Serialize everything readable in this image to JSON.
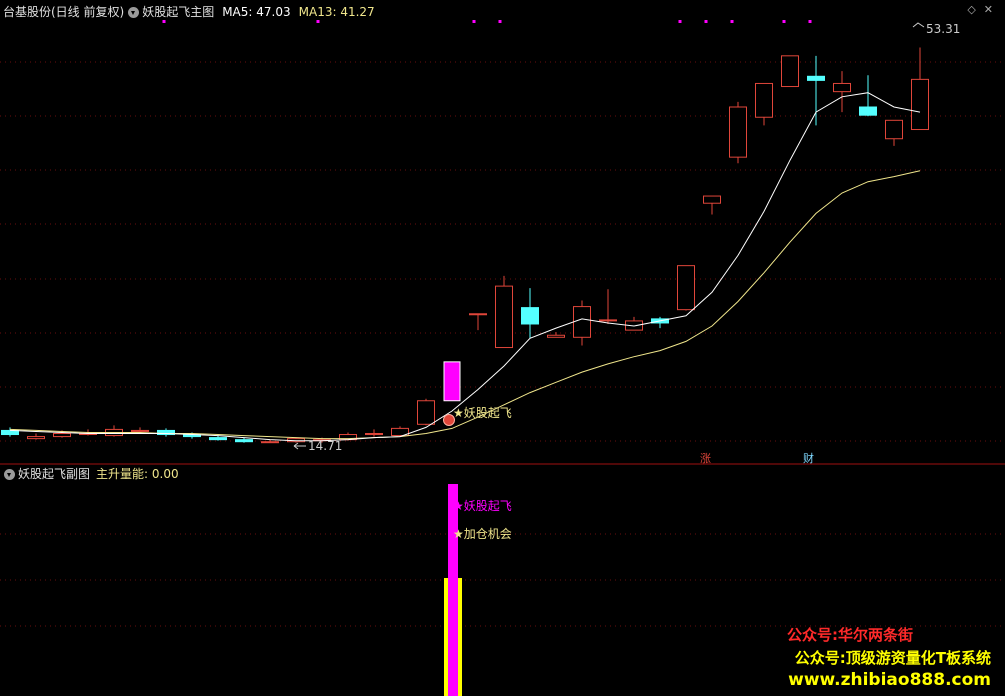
{
  "header": {
    "stock_name": "台基股份(日线 前复权)",
    "indicator_main": "妖股起飞主图",
    "ma5_label": "MA5: 47.03",
    "ma13_label": "MA13: 41.27"
  },
  "sub_header": {
    "indicator_sub": "妖股起飞副图",
    "value_label": "主升量能: 0.00"
  },
  "annotations": {
    "high_price": "53.31",
    "low_price": "14.71",
    "signal_main": "★妖股起飞",
    "signal_sub_1": "★妖股起飞",
    "signal_sub_2": "★加仓机会",
    "marker_zhang": "涨",
    "marker_cai": "财"
  },
  "watermark": {
    "line1": "公众号:华尔两条街",
    "line2": "公众号:顶级游资量化T板系统",
    "line3": "www.zhibiao888.com"
  },
  "colors": {
    "up": "#e0463a",
    "down": "#54ffff",
    "ma5": "#ffffff",
    "ma13": "#f0e68c",
    "signal": "#ff00ff",
    "volume_yellow": "#ffff00",
    "watermark_red": "#ff2a2a",
    "watermark_yellow": "#ffff00"
  },
  "chart_data": {
    "type": "candlestick",
    "price_range": [
      13.5,
      56
    ],
    "candles": [
      {
        "o": 15.9,
        "c": 15.5,
        "h": 16.2,
        "l": 15.3
      },
      {
        "o": 15.1,
        "c": 15.3,
        "h": 15.6,
        "l": 15.0
      },
      {
        "o": 15.3,
        "c": 15.6,
        "h": 15.9,
        "l": 15.2
      },
      {
        "o": 15.6,
        "c": 15.6,
        "h": 16.0,
        "l": 15.4
      },
      {
        "o": 15.4,
        "c": 16.0,
        "h": 16.4,
        "l": 15.3
      },
      {
        "o": 15.8,
        "c": 15.9,
        "h": 16.2,
        "l": 15.6
      },
      {
        "o": 15.9,
        "c": 15.5,
        "h": 16.1,
        "l": 15.3
      },
      {
        "o": 15.5,
        "c": 15.3,
        "h": 15.7,
        "l": 15.1
      },
      {
        "o": 15.2,
        "c": 15.0,
        "h": 15.4,
        "l": 14.9
      },
      {
        "o": 15.0,
        "c": 14.8,
        "h": 15.2,
        "l": 14.7
      },
      {
        "o": 14.8,
        "c": 14.8,
        "h": 15.0,
        "l": 14.7
      },
      {
        "o": 14.8,
        "c": 15.1,
        "h": 15.2,
        "l": 14.7
      },
      {
        "o": 14.9,
        "c": 15.0,
        "h": 15.2,
        "l": 14.71
      },
      {
        "o": 15.0,
        "c": 15.5,
        "h": 15.7,
        "l": 14.9
      },
      {
        "o": 15.5,
        "c": 15.6,
        "h": 16.0,
        "l": 15.3
      },
      {
        "o": 15.4,
        "c": 16.1,
        "h": 16.3,
        "l": 15.3
      },
      {
        "o": 16.5,
        "c": 18.8,
        "h": 19.0,
        "l": 16.4
      },
      {
        "o": 18.8,
        "c": 22.6,
        "h": 22.6,
        "l": 18.8
      },
      {
        "o": 27.3,
        "c": 27.3,
        "h": 27.3,
        "l": 25.7
      },
      {
        "o": 24.0,
        "c": 30.0,
        "h": 31.0,
        "l": 24.0
      },
      {
        "o": 27.9,
        "c": 26.3,
        "h": 29.8,
        "l": 24.9
      },
      {
        "o": 25.0,
        "c": 25.2,
        "h": 25.5,
        "l": 25.0
      },
      {
        "o": 25.0,
        "c": 28.0,
        "h": 28.6,
        "l": 24.2
      },
      {
        "o": 26.7,
        "c": 26.7,
        "h": 29.7,
        "l": 26.3
      },
      {
        "o": 25.7,
        "c": 26.6,
        "h": 27.0,
        "l": 25.7
      },
      {
        "o": 26.8,
        "c": 26.4,
        "h": 27.0,
        "l": 25.9
      },
      {
        "o": 27.7,
        "c": 32.0,
        "h": 32.0,
        "l": 27.6
      },
      {
        "o": 38.1,
        "c": 38.8,
        "h": 38.8,
        "l": 37.0
      },
      {
        "o": 42.6,
        "c": 47.5,
        "h": 48.0,
        "l": 42.0
      },
      {
        "o": 46.5,
        "c": 49.8,
        "h": 49.8,
        "l": 45.7
      },
      {
        "o": 49.5,
        "c": 52.5,
        "h": 52.5,
        "l": 49.5
      },
      {
        "o": 50.5,
        "c": 50.1,
        "h": 52.5,
        "l": 45.7
      },
      {
        "o": 49.0,
        "c": 49.8,
        "h": 51.0,
        "l": 47.0
      },
      {
        "o": 47.5,
        "c": 46.7,
        "h": 50.6,
        "l": 46.6
      },
      {
        "o": 44.4,
        "c": 46.2,
        "h": 46.2,
        "l": 43.7
      },
      {
        "o": 45.3,
        "c": 50.2,
        "h": 53.31,
        "l": 45.3
      }
    ],
    "ma5": [
      15.9,
      15.8,
      15.7,
      15.6,
      15.6,
      15.6,
      15.6,
      15.5,
      15.4,
      15.2,
      15.0,
      14.9,
      14.9,
      15.0,
      15.2,
      15.3,
      16.2,
      17.8,
      19.9,
      22.2,
      24.9,
      25.9,
      26.8,
      26.4,
      26.1,
      26.6,
      27.1,
      29.4,
      33.0,
      37.3,
      42.3,
      47.0,
      48.5,
      48.9,
      47.5,
      47.0
    ],
    "ma13": [
      16.0,
      15.9,
      15.8,
      15.7,
      15.7,
      15.7,
      15.6,
      15.6,
      15.5,
      15.4,
      15.3,
      15.2,
      15.1,
      15.1,
      15.2,
      15.3,
      15.6,
      16.1,
      17.2,
      18.4,
      19.6,
      20.6,
      21.6,
      22.4,
      23.1,
      23.7,
      24.6,
      26.1,
      28.5,
      31.3,
      34.3,
      37.1,
      39.1,
      40.2,
      40.7,
      41.27
    ],
    "volume_bar": {
      "index": 17,
      "main_ratio": 0.92,
      "yellow_ratio": 0.54
    }
  }
}
